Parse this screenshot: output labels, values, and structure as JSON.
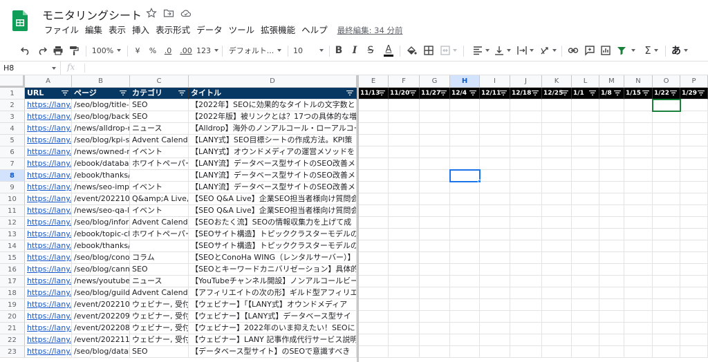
{
  "app": {
    "title": "モニタリングシート",
    "menu": [
      "ファイル",
      "編集",
      "表示",
      "挿入",
      "表示形式",
      "データ",
      "ツール",
      "拡張機能",
      "ヘルプ"
    ],
    "last_edit": "最終編集: 34 分前"
  },
  "toolbar": {
    "zoom": "100%",
    "currency": "¥",
    "percent": "%",
    "dec_decrease": ".0",
    "dec_increase": ".00",
    "number_format": "123",
    "font": "デフォルト...",
    "font_size": "10",
    "bold": "B",
    "italic": "I",
    "strike": "S",
    "text_color": "A",
    "input_tools": "あ",
    "accent_color": "#188038"
  },
  "formula_bar": {
    "cell_ref": "H8",
    "fx": "fx",
    "value": ""
  },
  "sheet": {
    "columns": [
      "A",
      "B",
      "C",
      "D",
      "E",
      "F",
      "G",
      "H",
      "I",
      "J",
      "K",
      "L",
      "M",
      "N",
      "O",
      "P"
    ],
    "selected_column": "H",
    "selected_row": "8",
    "header_row": [
      "URL",
      "ページ",
      "カテゴリ",
      "タイトル",
      "11/13",
      "11/20",
      "11/27",
      "12/4",
      "12/11",
      "12/18",
      "12/25",
      "1/1",
      "1/8",
      "1/15",
      "1/22",
      "1/29"
    ],
    "row_numbers": [
      "1",
      "2",
      "3",
      "4",
      "5",
      "6",
      "7",
      "8",
      "9",
      "10",
      "11",
      "12",
      "13",
      "14",
      "15",
      "16",
      "17",
      "18",
      "19",
      "20",
      "21",
      "22",
      "23"
    ],
    "rows": [
      [
        "https://lany.c",
        "/seo/blog/title-tag",
        "SEO",
        "【2022年】SEOに効果的なタイトルの文字数と"
      ],
      [
        "https://lany.c",
        "/seo/blog/backlinks",
        "SEO",
        "【2022年版】被リンクとは？17つの具体的な増"
      ],
      [
        "https://lany.c",
        "/news/alldrop-no",
        "ニュース",
        "【Alldrop】海外のノンアルコール・ローアルコー"
      ],
      [
        "https://lany.c",
        "/seo/blog/kpi-she",
        "Advent Calendar",
        "【LANY式】SEO目標シートの作成方法。KPI策"
      ],
      [
        "https://lany.c",
        "/news/owned-me",
        "イベント",
        "【LANY式】オウンドメディアの運営メソッドを"
      ],
      [
        "https://lany.c",
        "/ebook/database",
        "ホワイトペーパー",
        "【LANY流】データベース型サイトのSEO改善メ"
      ],
      [
        "https://lany.c",
        "/ebook/thanks/da",
        "",
        "【LANY流】データベース型サイトのSEO改善メ"
      ],
      [
        "https://lany.c",
        "/news/seo-impro",
        "イベント",
        "【LANY流】データベース型サイトのSEO改善メ"
      ],
      [
        "https://lany.c",
        "/event/20221019",
        "Q&amp;A Live, 受",
        "【SEO Q&A Live】企業SEO担当者様向け質問会"
      ],
      [
        "https://lany.c",
        "/news/seo-qa-liv",
        "イベント",
        "【SEO Q&A Live】企業SEO担当者様向け質問会"
      ],
      [
        "https://lany.c",
        "/seo/blog/informa",
        "Advent Calendar",
        "【SEOおたく流】SEOの情報収集力を上げて成"
      ],
      [
        "https://lany.c",
        "/ebook/topic-clus",
        "ホワイトペーパー",
        "【SEOサイト構造】トピッククラスターモデルの"
      ],
      [
        "https://lany.c",
        "/ebook/thanks/to",
        "",
        "【SEOサイト構造】トピッククラスターモデルの"
      ],
      [
        "https://lany.c",
        "/seo/blog/conoha",
        "コラム",
        "【SEOとConoHa WING（レンタルサーバー）】"
      ],
      [
        "https://lany.c",
        "/seo/blog/cannib",
        "SEO",
        "【SEOとキーワードカニバリゼーション】具体的"
      ],
      [
        "https://lany.c",
        "/news/youtube-c",
        "ニュース",
        "【YouTubeチャンネル開設】ノンアルコールビー"
      ],
      [
        "https://lany.c",
        "/seo/blog/guild-a",
        "Advent Calendar",
        "【アフィリエイトの次の形】ギルド型アフィリエ"
      ],
      [
        "https://lany.c",
        "/event/20221005",
        "ウェビナー, 受付",
        "【ウェビナー】「【LANY式】オウンドメディア"
      ],
      [
        "https://lany.c",
        "/event/20220907",
        "ウェビナー, 受付",
        "【ウェビナー】【LANY式】データベース型サイ"
      ],
      [
        "https://lany.c",
        "/event/20220824",
        "ウェビナー, 受付",
        "【ウェビナー】2022年のいま抑えたい！SEOに"
      ],
      [
        "https://lany.c",
        "/event/20221109",
        "ウェビナー, 受付",
        "【ウェビナー】LANY 記事作成代行サービス説明"
      ],
      [
        "https://lany.c",
        "/seo/blog/databa",
        "SEO",
        "【データベース型サイト】のSEOで意識すべき"
      ]
    ]
  }
}
